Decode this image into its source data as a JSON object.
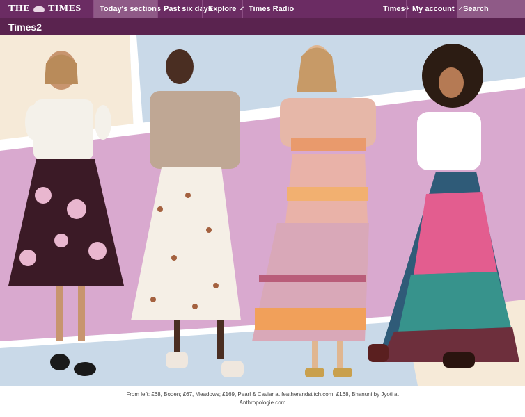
{
  "nav": {
    "logo_text_left": "THE",
    "logo_text_right": "TIMES",
    "items": [
      {
        "label": "Today's sections",
        "has_dropdown": true,
        "active": true
      },
      {
        "label": "Past six days",
        "has_dropdown": false
      },
      {
        "label": "Explore",
        "has_dropdown": true
      },
      {
        "label": "Times Radio",
        "has_dropdown": false
      }
    ],
    "right_items": [
      {
        "label": "Times+",
        "has_dropdown": false
      },
      {
        "label": "My account",
        "has_dropdown": true
      }
    ],
    "search_label": "Search"
  },
  "section": {
    "title": "Times2"
  },
  "hero": {
    "background_colors": {
      "cream": "#f6ead8",
      "blue": "#c9d9e8",
      "pink": "#d9a9cf",
      "white_band": "#ffffff"
    }
  },
  "caption": {
    "text": "From left: £68, Boden; £67, Meadows; £169, Pearl & Caviar at featherandstitch.com; £168, Bhanuni by Jyoti at Anthropologie.com"
  },
  "colors": {
    "nav_bg": "#6b2c63",
    "nav_active_bg": "#8f5a87",
    "section_bar_bg": "#5a234f"
  }
}
